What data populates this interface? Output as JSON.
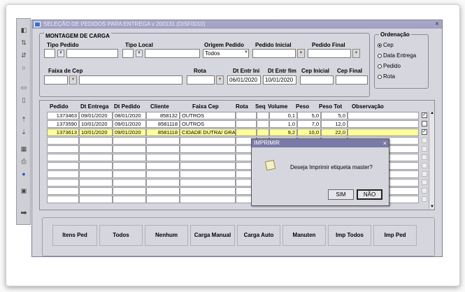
{
  "window": {
    "title": "SELEÇÃO DE PEDIDOS PARA ENTREGA v 200131 (DISF0010)",
    "close_glyph": "×"
  },
  "montagem": {
    "legend": "MONTAGEM DE CARGA",
    "tipo_pedido_label": "Tipo Pedido",
    "tipo_local_label": "Tipo Local",
    "origem_pedido_label": "Origem Pedido",
    "origem_pedido_value": "Todos",
    "pedido_inicial_label": "Pedido Inicial",
    "pedido_final_label": "Pedido Final",
    "faixa_cep_label": "Faixa de Cep",
    "rota_label": "Rota",
    "dt_entr_ini_label": "Dt Entr Ini",
    "dt_entr_ini_value": "06/01/2020",
    "dt_entr_fim_label": "Dt Entr fim",
    "dt_entr_fim_value": "10/01/2020",
    "cep_inicial_label": "Cep Inicial",
    "cep_final_label": "Cep Final"
  },
  "ordenacao": {
    "legend": "Ordenação",
    "options": [
      {
        "label": "Cep",
        "selected": true
      },
      {
        "label": "Data Entrega",
        "selected": false
      },
      {
        "label": "Pedido",
        "selected": false
      },
      {
        "label": "Rota",
        "selected": false
      }
    ]
  },
  "grid": {
    "headers": {
      "pedido": "Pedido",
      "dt_entrega": "Dt Entrega",
      "dt_pedido": "Dt Pedido",
      "cliente": "Cliente",
      "faixa_cep": "Faixa Cep",
      "rota": "Rota",
      "seq": "Seq",
      "volume": "Volume",
      "peso": "Peso",
      "peso_tot": "Peso Tot",
      "observacao": "Observação"
    },
    "rows": [
      {
        "pedido": "1373463",
        "dt_entrega": "09/01/2020",
        "dt_pedido": "08/01/2020",
        "cliente": "858132",
        "faixa_cep": "OUTROS",
        "rota": "",
        "seq": "",
        "volume": "0,1",
        "peso": "5,0",
        "peso_tot": "5,0",
        "observacao": "",
        "checked": true
      },
      {
        "pedido": "1373590",
        "dt_entrega": "10/01/2020",
        "dt_pedido": "09/01/2020",
        "cliente": "8581118",
        "faixa_cep": "OUTROS",
        "rota": "",
        "seq": "",
        "volume": "1,0",
        "peso": "7,0",
        "peso_tot": "12,0",
        "observacao": "",
        "checked": false
      },
      {
        "pedido": "1373613",
        "dt_entrega": "10/01/2020",
        "dt_pedido": "09/01/2020",
        "cliente": "8581118",
        "faixa_cep": "CIDADE DUTRA/ GRA",
        "rota": "",
        "seq": "",
        "volume": "9,2",
        "peso": "10,0",
        "peso_tot": "22,0",
        "observacao": "",
        "checked": true
      }
    ],
    "empty_rows": 8
  },
  "buttons": {
    "itens_ped": "Itens Ped",
    "todos": "Todos",
    "nenhum": "Nenhum",
    "carga_manual": "Carga Manual",
    "carga_auto": "Carga Auto",
    "manuten": "Manuten",
    "imp_todos": "Imp Todos",
    "imp_ped": "Imp Ped"
  },
  "dialog": {
    "title": "IMPRIMIR",
    "close_glyph": "×",
    "message": "Deseja Imprimir etiqueta master?",
    "yes_label": "SIM",
    "no_label": "NÃO"
  },
  "colors": {
    "selected_row": "#ffff99",
    "titlebar": "#9ea0c4",
    "dialog_titlebar": "#7a7aa8",
    "panel_bg": "#d6d6de"
  }
}
